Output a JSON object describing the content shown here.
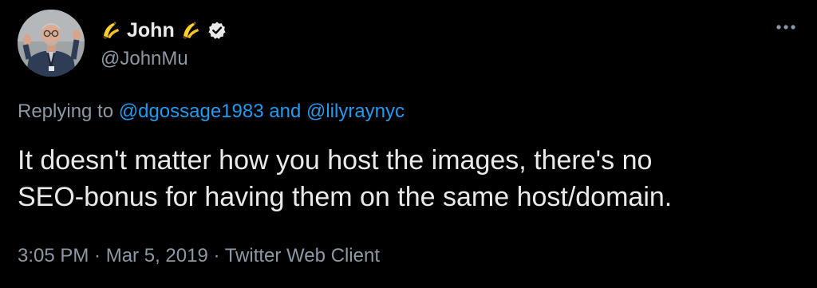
{
  "author": {
    "display_name": "John",
    "name_emoji_left": "banana-icon",
    "name_emoji_right": "banana-icon",
    "verified_icon": "verified-badge-icon",
    "handle": "@JohnMu",
    "avatar": "profile-photo"
  },
  "reply": {
    "prefix": "Replying to ",
    "mention_1": "@dgossage1983",
    "joiner": " and ",
    "mention_2": "@lilyraynyc"
  },
  "tweet": {
    "text": "It doesn't matter how you host the images, there's no\nSEO-bonus for having them on the same host/domain."
  },
  "meta": {
    "time": "3:05 PM",
    "separator_1": " · ",
    "date": "Mar 5, 2019",
    "separator_2": " · ",
    "client": "Twitter Web Client"
  },
  "actions": {
    "more_icon": "more-horizontal-icon"
  },
  "colors": {
    "background": "#000000",
    "primary_text": "#e7e9ea",
    "secondary_text": "#8b98a5",
    "link": "#1d9bf0"
  }
}
